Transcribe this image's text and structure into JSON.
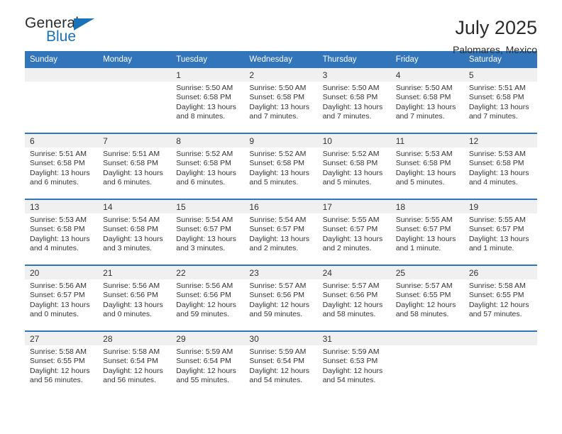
{
  "brand": {
    "name_part1": "General",
    "name_part2": "Blue",
    "triangle_icon": "triangle-icon",
    "accent_color": "#1a72b8"
  },
  "header": {
    "title": "July 2025",
    "location": "Palomares, Mexico"
  },
  "calendar": {
    "header_bg": "#3275ba",
    "daynum_bg": "#f0f0f0",
    "weekdays": [
      "Sunday",
      "Monday",
      "Tuesday",
      "Wednesday",
      "Thursday",
      "Friday",
      "Saturday"
    ],
    "weeks": [
      [
        {
          "day": "",
          "lines": []
        },
        {
          "day": "",
          "lines": []
        },
        {
          "day": "1",
          "lines": [
            "Sunrise: 5:50 AM",
            "Sunset: 6:58 PM",
            "Daylight: 13 hours",
            "and 8 minutes."
          ]
        },
        {
          "day": "2",
          "lines": [
            "Sunrise: 5:50 AM",
            "Sunset: 6:58 PM",
            "Daylight: 13 hours",
            "and 7 minutes."
          ]
        },
        {
          "day": "3",
          "lines": [
            "Sunrise: 5:50 AM",
            "Sunset: 6:58 PM",
            "Daylight: 13 hours",
            "and 7 minutes."
          ]
        },
        {
          "day": "4",
          "lines": [
            "Sunrise: 5:50 AM",
            "Sunset: 6:58 PM",
            "Daylight: 13 hours",
            "and 7 minutes."
          ]
        },
        {
          "day": "5",
          "lines": [
            "Sunrise: 5:51 AM",
            "Sunset: 6:58 PM",
            "Daylight: 13 hours",
            "and 7 minutes."
          ]
        }
      ],
      [
        {
          "day": "6",
          "lines": [
            "Sunrise: 5:51 AM",
            "Sunset: 6:58 PM",
            "Daylight: 13 hours",
            "and 6 minutes."
          ]
        },
        {
          "day": "7",
          "lines": [
            "Sunrise: 5:51 AM",
            "Sunset: 6:58 PM",
            "Daylight: 13 hours",
            "and 6 minutes."
          ]
        },
        {
          "day": "8",
          "lines": [
            "Sunrise: 5:52 AM",
            "Sunset: 6:58 PM",
            "Daylight: 13 hours",
            "and 6 minutes."
          ]
        },
        {
          "day": "9",
          "lines": [
            "Sunrise: 5:52 AM",
            "Sunset: 6:58 PM",
            "Daylight: 13 hours",
            "and 5 minutes."
          ]
        },
        {
          "day": "10",
          "lines": [
            "Sunrise: 5:52 AM",
            "Sunset: 6:58 PM",
            "Daylight: 13 hours",
            "and 5 minutes."
          ]
        },
        {
          "day": "11",
          "lines": [
            "Sunrise: 5:53 AM",
            "Sunset: 6:58 PM",
            "Daylight: 13 hours",
            "and 5 minutes."
          ]
        },
        {
          "day": "12",
          "lines": [
            "Sunrise: 5:53 AM",
            "Sunset: 6:58 PM",
            "Daylight: 13 hours",
            "and 4 minutes."
          ]
        }
      ],
      [
        {
          "day": "13",
          "lines": [
            "Sunrise: 5:53 AM",
            "Sunset: 6:58 PM",
            "Daylight: 13 hours",
            "and 4 minutes."
          ]
        },
        {
          "day": "14",
          "lines": [
            "Sunrise: 5:54 AM",
            "Sunset: 6:58 PM",
            "Daylight: 13 hours",
            "and 3 minutes."
          ]
        },
        {
          "day": "15",
          "lines": [
            "Sunrise: 5:54 AM",
            "Sunset: 6:57 PM",
            "Daylight: 13 hours",
            "and 3 minutes."
          ]
        },
        {
          "day": "16",
          "lines": [
            "Sunrise: 5:54 AM",
            "Sunset: 6:57 PM",
            "Daylight: 13 hours",
            "and 2 minutes."
          ]
        },
        {
          "day": "17",
          "lines": [
            "Sunrise: 5:55 AM",
            "Sunset: 6:57 PM",
            "Daylight: 13 hours",
            "and 2 minutes."
          ]
        },
        {
          "day": "18",
          "lines": [
            "Sunrise: 5:55 AM",
            "Sunset: 6:57 PM",
            "Daylight: 13 hours",
            "and 1 minute."
          ]
        },
        {
          "day": "19",
          "lines": [
            "Sunrise: 5:55 AM",
            "Sunset: 6:57 PM",
            "Daylight: 13 hours",
            "and 1 minute."
          ]
        }
      ],
      [
        {
          "day": "20",
          "lines": [
            "Sunrise: 5:56 AM",
            "Sunset: 6:57 PM",
            "Daylight: 13 hours",
            "and 0 minutes."
          ]
        },
        {
          "day": "21",
          "lines": [
            "Sunrise: 5:56 AM",
            "Sunset: 6:56 PM",
            "Daylight: 13 hours",
            "and 0 minutes."
          ]
        },
        {
          "day": "22",
          "lines": [
            "Sunrise: 5:56 AM",
            "Sunset: 6:56 PM",
            "Daylight: 12 hours",
            "and 59 minutes."
          ]
        },
        {
          "day": "23",
          "lines": [
            "Sunrise: 5:57 AM",
            "Sunset: 6:56 PM",
            "Daylight: 12 hours",
            "and 59 minutes."
          ]
        },
        {
          "day": "24",
          "lines": [
            "Sunrise: 5:57 AM",
            "Sunset: 6:56 PM",
            "Daylight: 12 hours",
            "and 58 minutes."
          ]
        },
        {
          "day": "25",
          "lines": [
            "Sunrise: 5:57 AM",
            "Sunset: 6:55 PM",
            "Daylight: 12 hours",
            "and 58 minutes."
          ]
        },
        {
          "day": "26",
          "lines": [
            "Sunrise: 5:58 AM",
            "Sunset: 6:55 PM",
            "Daylight: 12 hours",
            "and 57 minutes."
          ]
        }
      ],
      [
        {
          "day": "27",
          "lines": [
            "Sunrise: 5:58 AM",
            "Sunset: 6:55 PM",
            "Daylight: 12 hours",
            "and 56 minutes."
          ]
        },
        {
          "day": "28",
          "lines": [
            "Sunrise: 5:58 AM",
            "Sunset: 6:54 PM",
            "Daylight: 12 hours",
            "and 56 minutes."
          ]
        },
        {
          "day": "29",
          "lines": [
            "Sunrise: 5:59 AM",
            "Sunset: 6:54 PM",
            "Daylight: 12 hours",
            "and 55 minutes."
          ]
        },
        {
          "day": "30",
          "lines": [
            "Sunrise: 5:59 AM",
            "Sunset: 6:54 PM",
            "Daylight: 12 hours",
            "and 54 minutes."
          ]
        },
        {
          "day": "31",
          "lines": [
            "Sunrise: 5:59 AM",
            "Sunset: 6:53 PM",
            "Daylight: 12 hours",
            "and 54 minutes."
          ]
        },
        {
          "day": "",
          "lines": []
        },
        {
          "day": "",
          "lines": []
        }
      ]
    ]
  }
}
